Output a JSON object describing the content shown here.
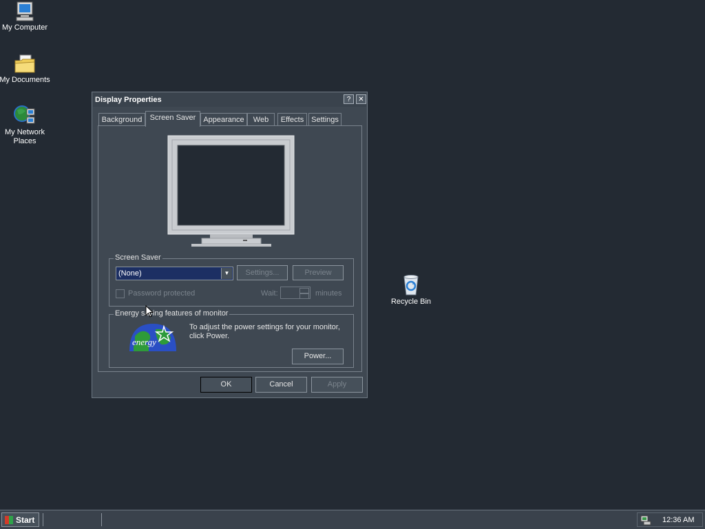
{
  "desktop": {
    "icons": [
      {
        "label_lines": [
          "My Computer"
        ],
        "icon": "computer-icon"
      },
      {
        "label_lines": [
          "My Documents"
        ],
        "icon": "documents-folder-icon"
      },
      {
        "label_lines": [
          "My Network",
          "Places"
        ],
        "icon": "network-places-icon"
      },
      {
        "label_lines": [
          "Recycle Bin"
        ],
        "icon": "recycle-bin-icon"
      }
    ]
  },
  "dialog": {
    "title": "Display Properties",
    "help_button": "?",
    "close_button": "✕",
    "tabs": [
      "Background",
      "Screen Saver",
      "Appearance",
      "Web",
      "Effects",
      "Settings"
    ],
    "active_tab": "Screen Saver",
    "screen_saver": {
      "group_label": "Screen Saver",
      "selected": "(None)",
      "settings_button": "Settings...",
      "preview_button": "Preview",
      "password_protected_label": "Password protected",
      "wait_label": "Wait:",
      "wait_value": "",
      "minutes_label": "minutes"
    },
    "energy": {
      "group_label": "Energy saving features of monitor",
      "text": "To adjust the power settings for your monitor, click Power.",
      "logo_text": "energy",
      "power_button": "Power..."
    },
    "ok_button": "OK",
    "cancel_button": "Cancel",
    "apply_button": "Apply"
  },
  "taskbar": {
    "start_label": "Start",
    "clock": "12:36 AM"
  }
}
